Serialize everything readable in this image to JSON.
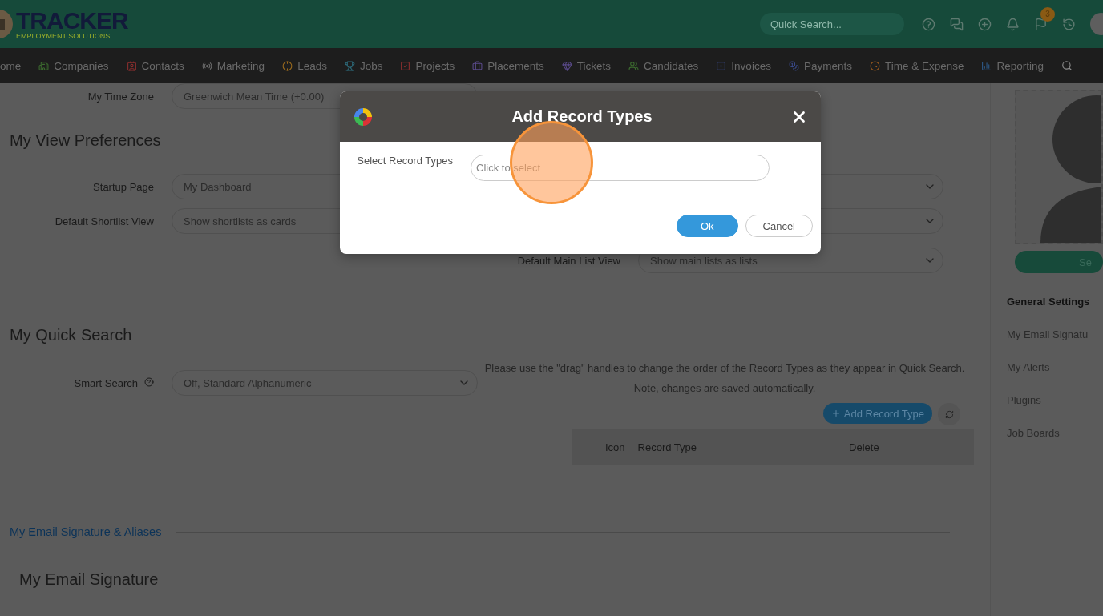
{
  "header": {
    "logo": {
      "title": "TRACKER",
      "subtitle": "EMPLOYMENT SOLUTIONS"
    },
    "search": {
      "placeholder": "Quick Search..."
    },
    "flag_badge": "3"
  },
  "nav": [
    {
      "label": "ome"
    },
    {
      "label": "Companies"
    },
    {
      "label": "Contacts"
    },
    {
      "label": "Marketing"
    },
    {
      "label": "Leads"
    },
    {
      "label": "Jobs"
    },
    {
      "label": "Projects"
    },
    {
      "label": "Placements"
    },
    {
      "label": "Tickets"
    },
    {
      "label": "Candidates"
    },
    {
      "label": "Invoices"
    },
    {
      "label": "Payments"
    },
    {
      "label": "Time & Expense"
    },
    {
      "label": "Reporting"
    }
  ],
  "time_zone": {
    "label": "My Time Zone",
    "value": "Greenwich Mean Time (+0.00)"
  },
  "view_preferences": {
    "title": "My View Preferences",
    "left": [
      {
        "label": "Startup Page",
        "value": "My Dashboard"
      },
      {
        "label": "Default Shortlist View",
        "value": "Show shortlists as cards"
      }
    ],
    "right": [
      {
        "kind": "hidden"
      },
      {
        "kind": "hidden"
      },
      {
        "kind": "select",
        "label": "Default Main List View",
        "value": "Show main lists as lists"
      }
    ]
  },
  "quick_search": {
    "title": "My Quick Search",
    "smart_search": {
      "label": "Smart Search",
      "value": "Off, Standard Alphanumeric"
    },
    "note": "Please use the \"drag\" handles to change the order of the Record Types as they appear in Quick Search.",
    "note2": "Note, changes are saved automatically.",
    "add_button": "Add Record Type",
    "table": {
      "columns": [
        "Icon",
        "Record Type",
        "Delete"
      ]
    }
  },
  "email_section": {
    "link": "My Email Signature & Aliases",
    "title": "My Email Signature"
  },
  "sidebar": {
    "button": "Se",
    "items": [
      {
        "label": "General Settings",
        "selected": true
      },
      {
        "label": "My Email Signatu",
        "selected": false
      },
      {
        "label": "My Alerts",
        "selected": false
      },
      {
        "label": "Plugins",
        "selected": false
      },
      {
        "label": "Job Boards",
        "selected": false
      }
    ]
  },
  "modal": {
    "title": "Add Record Types",
    "field_label": "Select Record Types",
    "placeholder": "Click to select",
    "buttons": [
      {
        "label": "Ok",
        "kind": "primary"
      },
      {
        "label": "Cancel",
        "kind": "secondary"
      }
    ]
  }
}
